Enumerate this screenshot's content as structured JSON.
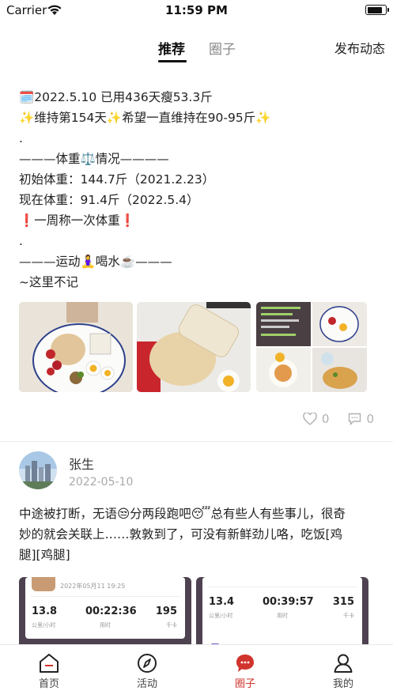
{
  "status_bar": {
    "carrier": "Carrier",
    "time": "11:59 PM",
    "battery_level": 0.9
  },
  "header": {
    "tabs": [
      {
        "label": "推荐",
        "active": true
      },
      {
        "label": "圈子",
        "active": false
      }
    ],
    "publish": "发布动态"
  },
  "post1": {
    "lines": [
      "🗓️2022.5.10    已用436天瘦53.3斤",
      "✨维持第154天✨希望一直维持在90-95斤✨",
      ".",
      "———体重⚖️情况————",
      "初始体重：144.7斤（2021.2.23）",
      "现在体重：91.4斤（2022.5.4）",
      "❗️一周称一次体重❗️",
      ".",
      "———运动🧘‍♀️喝水☕️———",
      "~这里不记"
    ],
    "likes": "0",
    "comments": "0"
  },
  "post2": {
    "author": "张生",
    "date": "2022-05-10",
    "lines": [
      "中途被打断，无语😒分两段跑吧😴总有些人有些事儿，很奇",
      "妙的就会关联上……敦敦到了，可没有新鲜劲儿咯，吃饭[鸡",
      "腿][鸡腿]"
    ],
    "cards": [
      {
        "header": "2022年05月11 19:25",
        "speed": "13.8",
        "speed_label": "公里/小时",
        "duration": "00:22:36",
        "duration_label": "用时",
        "calories": "195",
        "calories_label": "千卡"
      },
      {
        "speed": "13.4",
        "speed_label": "公里/小时",
        "duration": "00:39:57",
        "duration_label": "用时",
        "calories": "315",
        "calories_label": "千卡"
      }
    ]
  },
  "tabbar": {
    "items": [
      {
        "label": "首页",
        "icon": "home-icon"
      },
      {
        "label": "活动",
        "icon": "compass-icon"
      },
      {
        "label": "圈子",
        "icon": "chat-bubble-icon",
        "active": true
      },
      {
        "label": "我的",
        "icon": "person-icon"
      }
    ]
  },
  "colors": {
    "accent": "#d0342c",
    "card_bg": "#4e4250",
    "muted": "#a9a9a9"
  }
}
